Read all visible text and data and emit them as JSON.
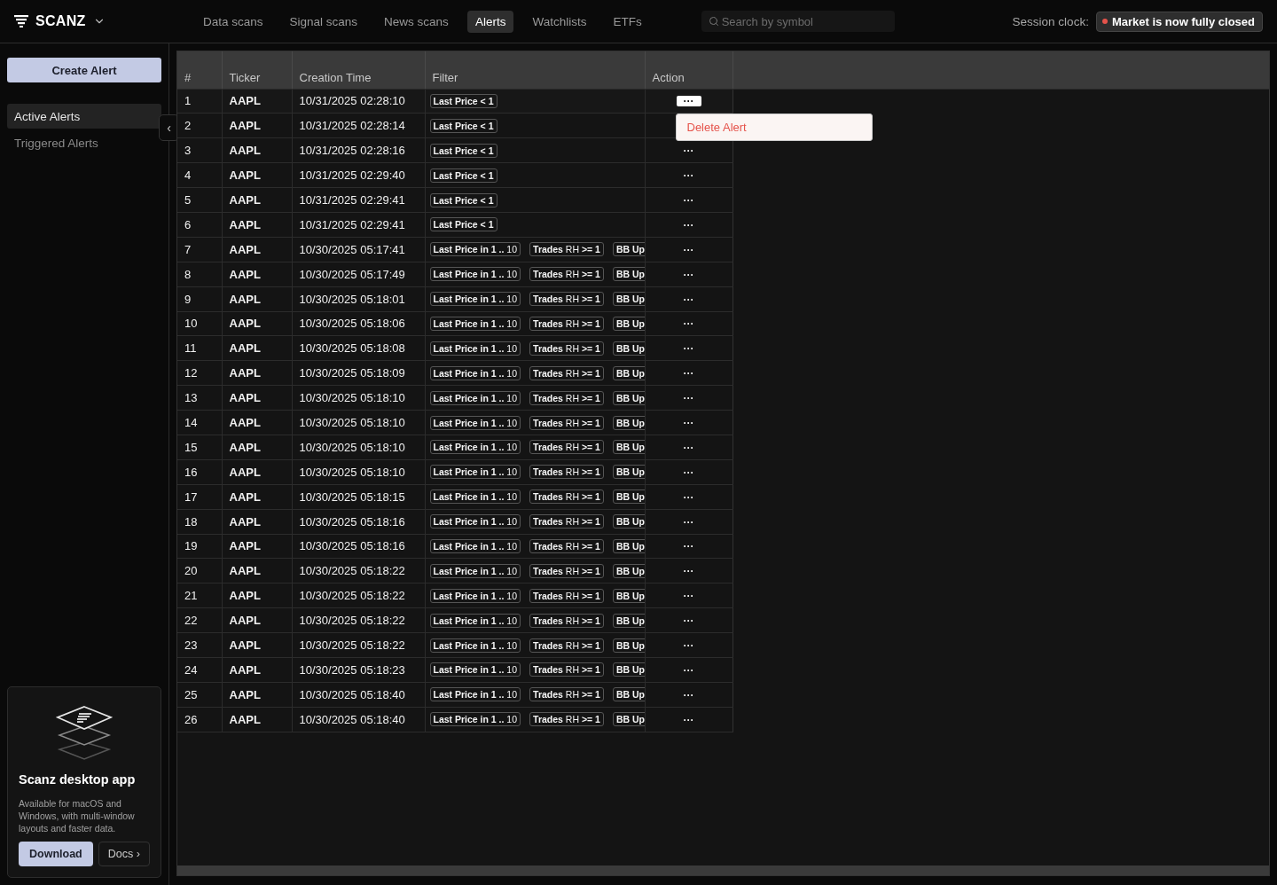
{
  "brand": {
    "name": "SCANZ"
  },
  "nav": [
    {
      "label": "Data scans",
      "selected": false
    },
    {
      "label": "Signal scans",
      "selected": false
    },
    {
      "label": "News scans",
      "selected": false
    },
    {
      "label": "Alerts",
      "selected": true
    },
    {
      "label": "Watchlists",
      "selected": false
    },
    {
      "label": "ETFs",
      "selected": false
    }
  ],
  "search": {
    "placeholder": "Search by symbol"
  },
  "session": {
    "label": "Session clock:",
    "status": "Market is now fully closed",
    "color": "#e5534b"
  },
  "sidebar": {
    "create_button": "Create Alert",
    "items": [
      {
        "label": "Active Alerts",
        "selected": true
      },
      {
        "label": "Triggered Alerts",
        "selected": false
      }
    ],
    "collapse": "‹",
    "promo": {
      "title": "Scanz desktop app",
      "text": "Available for macOS and Windows, with multi-window layouts and faster data.",
      "primary": "Download",
      "secondary": "Docs ›"
    }
  },
  "table": {
    "columns": [
      "#",
      "Ticker",
      "Creation Time",
      "Filter",
      "Action"
    ],
    "rows": [
      {
        "n": "1",
        "ticker": "AAPL",
        "time": "10/31/2025 02:28:10",
        "filters": [
          "Last Price < 1"
        ],
        "action": "···",
        "menu_open": true
      },
      {
        "n": "2",
        "ticker": "AAPL",
        "time": "10/31/2025 02:28:14",
        "filters": [
          "Last Price < 1"
        ],
        "menu_open": false
      },
      {
        "n": "3",
        "ticker": "AAPL",
        "time": "10/31/2025 02:28:16",
        "filters": [
          "Last Price < 1"
        ],
        "action": "···",
        "menu_open": false
      },
      {
        "n": "4",
        "ticker": "AAPL",
        "time": "10/31/2025 02:29:40",
        "filters": [
          "Last Price < 1"
        ],
        "action": "···",
        "menu_open": false
      },
      {
        "n": "5",
        "ticker": "AAPL",
        "time": "10/31/2025 02:29:41",
        "filters": [
          "Last Price < 1"
        ],
        "action": "···",
        "menu_open": false
      },
      {
        "n": "6",
        "ticker": "AAPL",
        "time": "10/31/2025 02:29:41",
        "filters": [
          "Last Price < 1"
        ],
        "action": "···",
        "menu_open": false
      },
      {
        "n": "7",
        "ticker": "AAPL",
        "time": "10/30/2025 05:17:41",
        "filters": [
          "**Last Price in 1 ..** 10",
          "**Trades** RH **>= 1**",
          "BB Up"
        ],
        "action": "···",
        "menu_open": false
      },
      {
        "n": "8",
        "ticker": "AAPL",
        "time": "10/30/2025 05:17:49",
        "filters": [
          "**Last Price in 1 ..** 10",
          "**Trades** RH **>= 1**",
          "BB Up"
        ],
        "action": "···",
        "menu_open": false
      },
      {
        "n": "9",
        "ticker": "AAPL",
        "time": "10/30/2025 05:18:01",
        "filters": [
          "**Last Price in 1 ..** 10",
          "**Trades** RH **>= 1**",
          "BB Up"
        ],
        "action": "···",
        "menu_open": false
      },
      {
        "n": "10",
        "ticker": "AAPL",
        "time": "10/30/2025 05:18:06",
        "filters": [
          "**Last Price in 1 ..** 10",
          "**Trades** RH **>= 1**",
          "BB Up"
        ],
        "action": "···",
        "menu_open": false
      },
      {
        "n": "11",
        "ticker": "AAPL",
        "time": "10/30/2025 05:18:08",
        "filters": [
          "**Last Price in 1 ..** 10",
          "**Trades** RH **>= 1**",
          "BB Up"
        ],
        "action": "···",
        "menu_open": false
      },
      {
        "n": "12",
        "ticker": "AAPL",
        "time": "10/30/2025 05:18:09",
        "filters": [
          "**Last Price in 1 ..** 10",
          "**Trades** RH **>= 1**",
          "BB Up"
        ],
        "action": "···",
        "menu_open": false
      },
      {
        "n": "13",
        "ticker": "AAPL",
        "time": "10/30/2025 05:18:10",
        "filters": [
          "**Last Price in 1 ..** 10",
          "**Trades** RH **>= 1**",
          "BB Up"
        ],
        "action": "···",
        "menu_open": false
      },
      {
        "n": "14",
        "ticker": "AAPL",
        "time": "10/30/2025 05:18:10",
        "filters": [
          "**Last Price in 1 ..** 10",
          "**Trades** RH **>= 1**",
          "BB Up"
        ],
        "action": "···",
        "menu_open": false
      },
      {
        "n": "15",
        "ticker": "AAPL",
        "time": "10/30/2025 05:18:10",
        "filters": [
          "**Last Price in 1 ..** 10",
          "**Trades** RH **>= 1**",
          "BB Up"
        ],
        "action": "···",
        "menu_open": false
      },
      {
        "n": "16",
        "ticker": "AAPL",
        "time": "10/30/2025 05:18:10",
        "filters": [
          "**Last Price in 1 ..** 10",
          "**Trades** RH **>= 1**",
          "BB Up"
        ],
        "action": "···",
        "menu_open": false
      },
      {
        "n": "17",
        "ticker": "AAPL",
        "time": "10/30/2025 05:18:15",
        "filters": [
          "**Last Price in 1 ..** 10",
          "**Trades** RH **>= 1**",
          "BB Up"
        ],
        "action": "···",
        "menu_open": false
      },
      {
        "n": "18",
        "ticker": "AAPL",
        "time": "10/30/2025 05:18:16",
        "filters": [
          "**Last Price in 1 ..** 10",
          "**Trades** RH **>= 1**",
          "BB Up"
        ],
        "action": "···",
        "menu_open": false
      },
      {
        "n": "19",
        "ticker": "AAPL",
        "time": "10/30/2025 05:18:16",
        "filters": [
          "**Last Price in 1 ..** 10",
          "**Trades** RH **>= 1**",
          "BB Up"
        ],
        "action": "···",
        "menu_open": false
      },
      {
        "n": "20",
        "ticker": "AAPL",
        "time": "10/30/2025 05:18:22",
        "filters": [
          "**Last Price in 1 ..** 10",
          "**Trades** RH **>= 1**",
          "BB Up"
        ],
        "action": "···",
        "menu_open": false
      },
      {
        "n": "21",
        "ticker": "AAPL",
        "time": "10/30/2025 05:18:22",
        "filters": [
          "**Last Price in 1 ..** 10",
          "**Trades** RH **>= 1**",
          "BB Up"
        ],
        "action": "···",
        "menu_open": false
      },
      {
        "n": "22",
        "ticker": "AAPL",
        "time": "10/30/2025 05:18:22",
        "filters": [
          "**Last Price in 1 ..** 10",
          "**Trades** RH **>= 1**",
          "BB Up"
        ],
        "action": "···",
        "menu_open": false
      },
      {
        "n": "23",
        "ticker": "AAPL",
        "time": "10/30/2025 05:18:22",
        "filters": [
          "**Last Price in 1 ..** 10",
          "**Trades** RH **>= 1**",
          "BB Up"
        ],
        "action": "···",
        "menu_open": false
      },
      {
        "n": "24",
        "ticker": "AAPL",
        "time": "10/30/2025 05:18:23",
        "filters": [
          "**Last Price in 1 ..** 10",
          "**Trades** RH **>= 1**",
          "BB Up"
        ],
        "action": "···",
        "menu_open": false
      },
      {
        "n": "25",
        "ticker": "AAPL",
        "time": "10/30/2025 05:18:40",
        "filters": [
          "**Last Price in 1 ..** 10",
          "**Trades** RH **>= 1**",
          "BB Up"
        ],
        "action": "···",
        "menu_open": false
      },
      {
        "n": "26",
        "ticker": "AAPL",
        "time": "10/30/2025 05:18:40",
        "filters": [
          "**Last Price in 1 ..** 10",
          "**Trades** RH **>= 1**",
          "BB Up"
        ],
        "action": "···",
        "menu_open": false
      }
    ]
  },
  "action_menu": {
    "items": [
      "Delete Alert"
    ]
  }
}
